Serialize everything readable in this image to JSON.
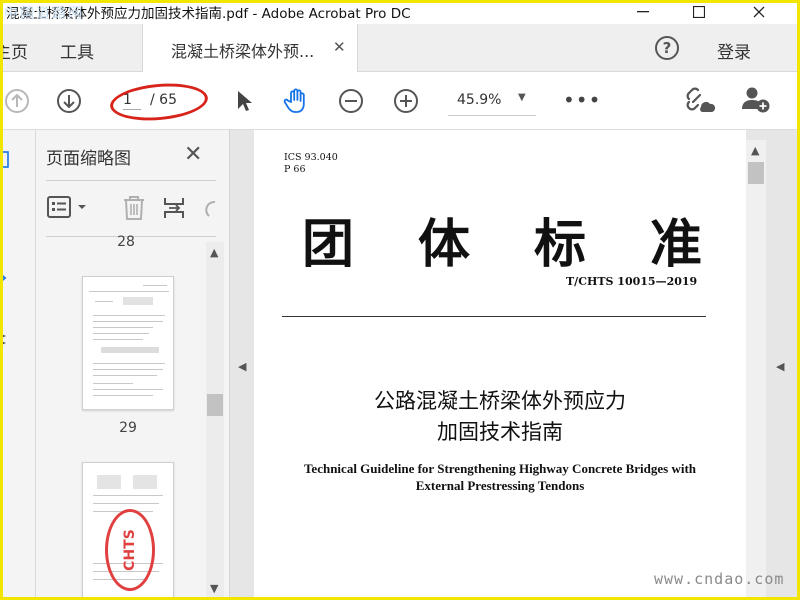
{
  "window": {
    "title": "混凝土桥梁体外预应力加固技术指南.pdf - Adobe Acrobat Pro DC",
    "overlay_text": "中国道路网"
  },
  "tabs": {
    "home": "主页",
    "tools": "工具",
    "document": "混凝土桥梁体外预...",
    "login": "登录"
  },
  "toolbar": {
    "page_current": "1",
    "page_total": "/ 65",
    "zoom": "45.9%"
  },
  "thumbnail_panel": {
    "title": "页面缩略图",
    "page_numbers": [
      "28",
      "29"
    ],
    "stamp_text": "CHTS"
  },
  "document": {
    "ics": "ICS 93.040",
    "p": "P 66",
    "big_title_chars": [
      "团",
      "体",
      "标",
      "准"
    ],
    "standard_no": "T/CHTS 10015—2019",
    "title_cn_line1": "公路混凝土桥梁体外预应力",
    "title_cn_line2": "加固技术指南",
    "title_en_line1": "Technical Guideline for Strengthening Highway Concrete Bridges with",
    "title_en_line2": "External Prestressing Tendons"
  },
  "watermark": "www.cndao.com",
  "colors": {
    "highlight_circle": "#d8231b",
    "frame": "#f2e600",
    "stamp": "#e04040"
  }
}
